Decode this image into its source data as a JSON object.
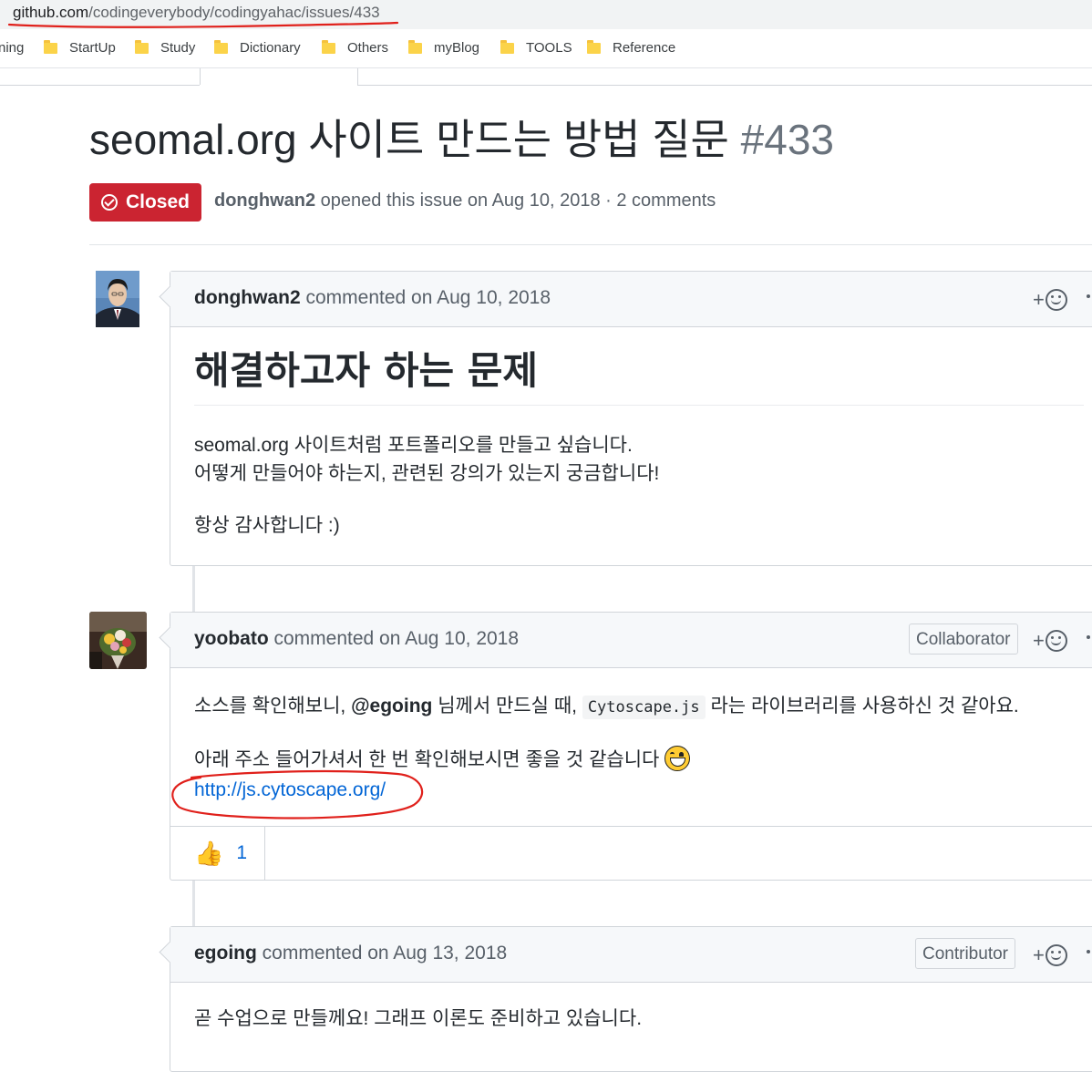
{
  "browser": {
    "url_host": "github.com",
    "url_path": "/codingeverybody/codingyahac/issues/433",
    "bookmarks": [
      {
        "label": "ning",
        "icon": "folder-icon",
        "partial": true
      },
      {
        "label": "StartUp",
        "icon": "folder-icon"
      },
      {
        "label": "Study",
        "icon": "folder-icon"
      },
      {
        "label": "Dictionary",
        "icon": "folder-icon"
      },
      {
        "label": "Others",
        "icon": "folder-icon"
      },
      {
        "label": "myBlog",
        "icon": "folder-icon"
      },
      {
        "label": "TOOLS",
        "icon": "folder-icon"
      },
      {
        "label": "Reference",
        "icon": "folder-icon"
      }
    ]
  },
  "issue": {
    "title": "seomal.org 사이트 만드는 방법 질문",
    "number": "#433",
    "state": "Closed",
    "state_color": "#cb2431",
    "author": "donghwan2",
    "meta_rest": " opened this issue on Aug 10, 2018 · 2 comments"
  },
  "comments": [
    {
      "author": "donghwan2",
      "action": " commented on Aug 10, 2018",
      "heading": "해결하고자 하는 문제",
      "lines": [
        "seomal.org 사이트처럼 포트폴리오를 만들고 싶습니다.",
        "어떻게 만들어야 하는지, 관련된 강의가 있는지 궁금합니다!",
        "항상 감사합니다 :)"
      ]
    },
    {
      "author": "yoobato",
      "action": " commented on Aug 10, 2018",
      "role": "Collaborator",
      "line1_pre": "소스를 확인해보니, ",
      "mention": "@egoing",
      "line1_mid": " 님께서 만드실 때, ",
      "code": "Cytoscape.js",
      "line1_post": " 라는 라이브러리를 사용하신 것 같아요.",
      "line2": "아래 주소 들어가셔서 한 번 확인해보시면 좋을 것 같습니다",
      "emoji": "grinning-face-icon",
      "link": "http://js.cytoscape.org/",
      "reaction_count": "1",
      "reaction_icon": "thumbs-up-icon"
    },
    {
      "author": "egoing",
      "action": " commented on Aug 13, 2018",
      "role": "Contributor",
      "line1": "곧 수업으로 만들께요! 그래프 이론도 준비하고 있습니다."
    }
  ],
  "ui": {
    "add_reaction": "+",
    "annotation_color": "#e0201b"
  }
}
